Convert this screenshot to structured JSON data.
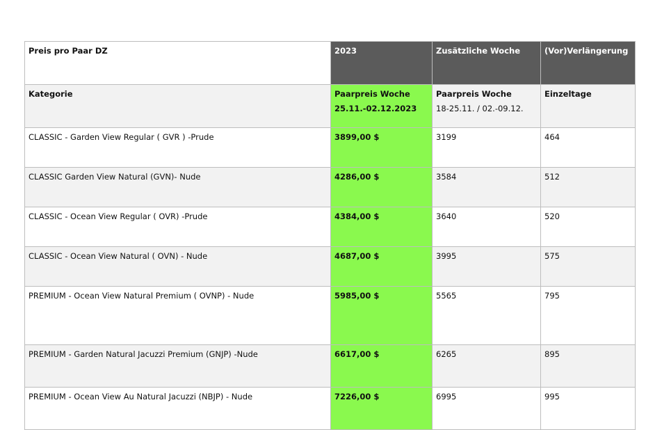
{
  "header": {
    "col1": "Preis pro Paar DZ",
    "col2": "2023",
    "col3": "Zusätzliche Woche",
    "col4": "(Vor)Verlängerung"
  },
  "subheader": {
    "col1": "Kategorie",
    "col2_line1": "Paarpreis Woche",
    "col2_line2": "25.11.-02.12.2023",
    "col3_line1": "Paarpreis Woche",
    "col3_line2": "18-25.11. / 02.-09.12.",
    "col4": "Einzeltage"
  },
  "rows": [
    {
      "category": "CLASSIC - Garden View Regular ( GVR ) -Prude",
      "price": "3899,00 $",
      "extra_week": "3199",
      "single_days": "464"
    },
    {
      "category": "CLASSIC Garden View Natural (GVN)- Nude",
      "price": "4286,00 $",
      "extra_week": "3584",
      "single_days": "512"
    },
    {
      "category": "CLASSIC - Ocean View Regular ( OVR) -Prude",
      "price": "4384,00 $",
      "extra_week": "3640",
      "single_days": "520"
    },
    {
      "category": "CLASSIC - Ocean View Natural ( OVN) - Nude",
      "price": "4687,00 $",
      "extra_week": "3995",
      "single_days": "575"
    },
    {
      "category": "PREMIUM - Ocean View Natural Premium ( OVNP) - Nude",
      "price": "5985,00 $",
      "extra_week": "5565",
      "single_days": "795"
    },
    {
      "category": "PREMIUM - Garden Natural Jacuzzi Premium (GNJP) -Nude",
      "price": "6617,00 $",
      "extra_week": "6265",
      "single_days": "895"
    },
    {
      "category": "PREMIUM - Ocean View Au Natural Jacuzzi (NBJP) - Nude",
      "price": "7226,00 $",
      "extra_week": "6995",
      "single_days": "995"
    }
  ],
  "colors": {
    "header_dark": "#5b5b5b",
    "highlight_green": "#8af94e",
    "alt_row": "#f2f2f2"
  }
}
